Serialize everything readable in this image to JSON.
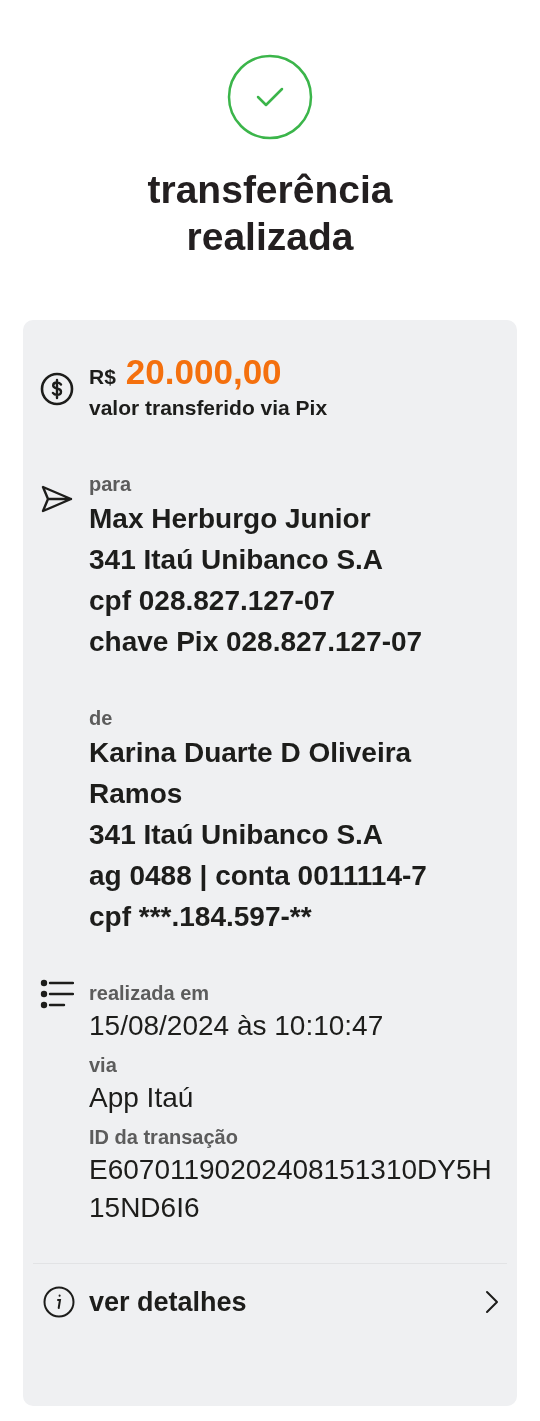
{
  "status": {
    "title": "transferência realizada"
  },
  "amount": {
    "currency": "R$",
    "value": "20.000,00",
    "caption": "valor transferido via Pix"
  },
  "parties": [
    {
      "kind": "recipient",
      "label": "para",
      "lines": [
        "Max Herburgo Junior",
        "341 Itaú Unibanco S.A",
        "cpf 028.827.127-07",
        "chave Pix 028.827.127-07"
      ]
    },
    {
      "kind": "sender",
      "label": "de",
      "lines": [
        "Karina Duarte D Oliveira Ramos",
        "341 Itaú Unibanco S.A",
        "ag 0488 | conta 0011114-7",
        "cpf ***.184.597-**"
      ]
    }
  ],
  "details": [
    {
      "label": "realizada em",
      "value": "15/08/2024 às 10:10:47"
    },
    {
      "label": "via",
      "value": "App Itaú"
    },
    {
      "label": "ID da transação",
      "value": "E60701190202408151310DY5H15ND6I6"
    }
  ],
  "link": {
    "label": "ver detalhes"
  }
}
